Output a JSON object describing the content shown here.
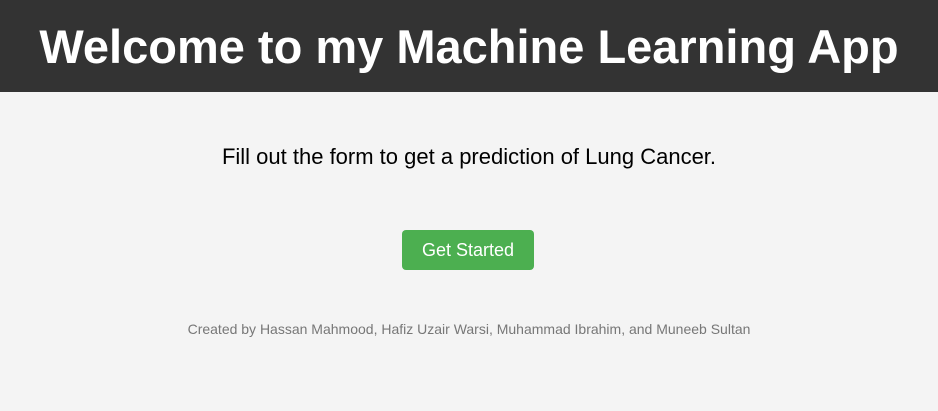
{
  "header": {
    "title": "Welcome to my Machine Learning App"
  },
  "main": {
    "subtitle": "Fill out the form to get a prediction of Lung Cancer.",
    "cta_label": "Get Started"
  },
  "footer": {
    "credits": "Created by Hassan Mahmood, Hafiz Uzair Warsi, Muhammad Ibrahim, and Muneeb Sultan"
  },
  "colors": {
    "header_bg": "#333333",
    "page_bg": "#f4f4f4",
    "button_bg": "#4caf50",
    "credits_text": "#777777"
  }
}
